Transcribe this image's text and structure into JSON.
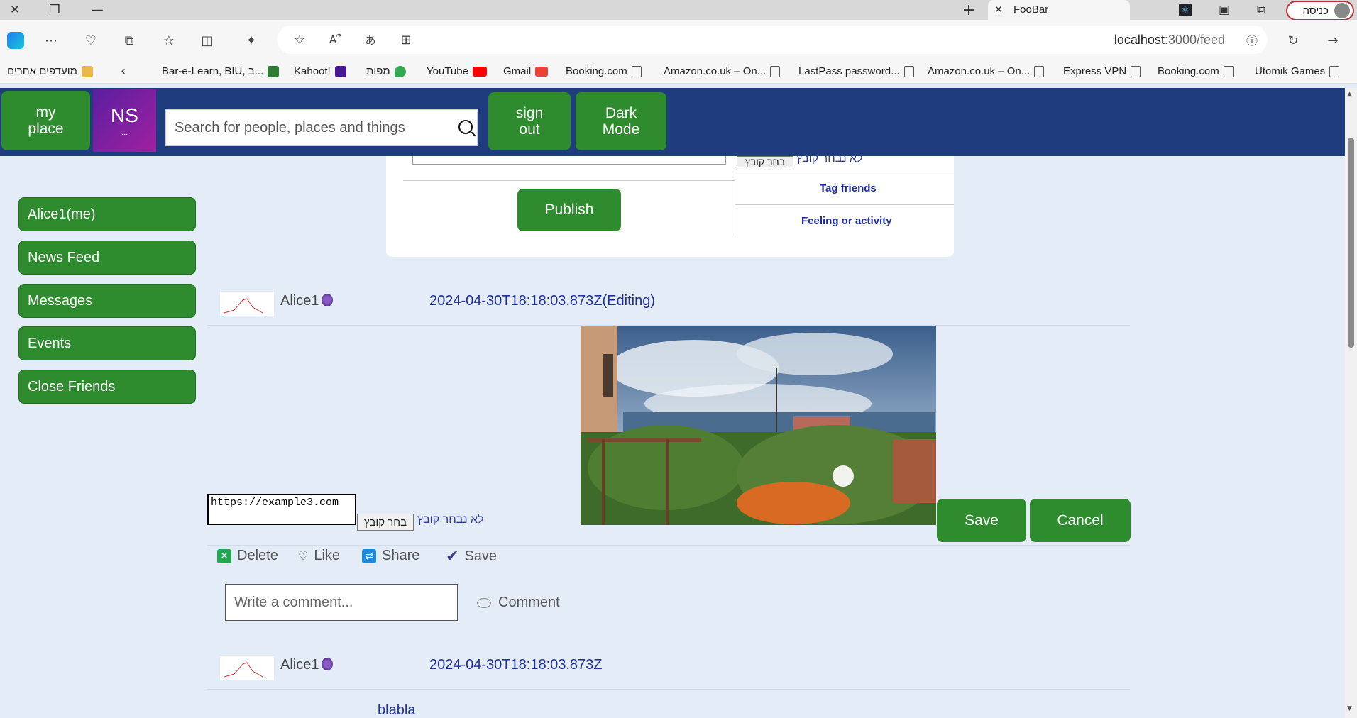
{
  "browser": {
    "tab_title": "FooBar",
    "profile_label": "כניסה",
    "url_host": "localhost",
    "url_path": ":3000/feed",
    "bookmarks": [
      {
        "label": "Bar-e-Learn, BIU, ב...",
        "icon_color": "#2e7d32"
      },
      {
        "label": "Kahoot!",
        "icon_color": "#46178f"
      },
      {
        "label": "מפות",
        "icon_color": "#34a853"
      },
      {
        "label": "YouTube",
        "icon_color": "#ff0000"
      },
      {
        "label": "Gmail",
        "icon_color": "#ea4335"
      },
      {
        "label": "Booking.com",
        "icon_color": ""
      },
      {
        "label": "Amazon.co.uk – On...",
        "icon_color": ""
      },
      {
        "label": "LastPass password...",
        "icon_color": ""
      },
      {
        "label": "Amazon.co.uk – On...",
        "icon_color": ""
      },
      {
        "label": "Express VPN",
        "icon_color": ""
      },
      {
        "label": "Booking.com",
        "icon_color": ""
      },
      {
        "label": "Utomik Games",
        "icon_color": ""
      }
    ],
    "other_favorites": "מועדפים אחרים"
  },
  "header": {
    "my_place": "my place",
    "logo": "NS",
    "search_placeholder": "Search for people, places and things",
    "sign_out": "sign out",
    "dark_mode": "Dark Mode"
  },
  "sidebar": {
    "items": [
      {
        "label": "Alice1(me)"
      },
      {
        "label": "News Feed"
      },
      {
        "label": "Messages"
      },
      {
        "label": "Events"
      },
      {
        "label": "Close Friends"
      }
    ]
  },
  "composer": {
    "choose_file": "בחר קובץ",
    "no_file": "לא נבחר קובץ",
    "tag_friends": "Tag friends",
    "feeling": "Feeling or activity",
    "publish": "Publish"
  },
  "posts": [
    {
      "author": "Alice1",
      "timestamp": "2024-04-30T18:18:03.873Z(Editing)",
      "edit_value": "https://example3.com",
      "choose_file": "בחר קובץ",
      "no_file": "לא נבחר קובץ",
      "save": "Save",
      "cancel": "Cancel",
      "actions": {
        "delete": "Delete",
        "like": "Like",
        "share": "Share",
        "save": "Save"
      },
      "comment_placeholder": "Write a comment...",
      "comment_button": "Comment"
    },
    {
      "author": "Alice1",
      "timestamp": "2024-04-30T18:18:03.873Z",
      "text": "blabla"
    }
  ],
  "colors": {
    "brand_green": "#2e8b2e",
    "header_blue": "#1f3d7e",
    "page_bg": "#e4ecf8",
    "link_blue": "#1f2f9a"
  }
}
